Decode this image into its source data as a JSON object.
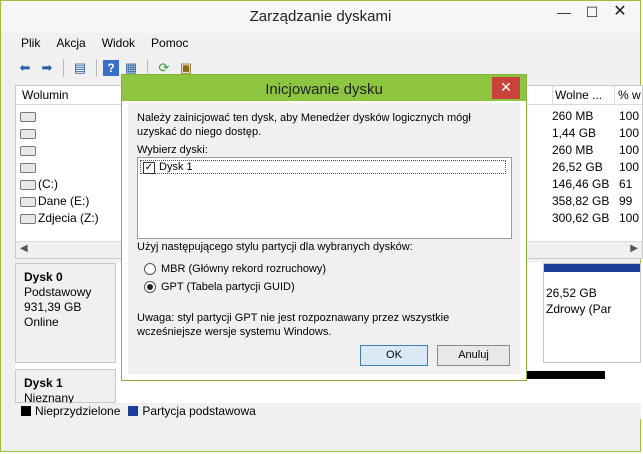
{
  "window": {
    "title": "Zarządzanie dyskami",
    "minimize": "—",
    "maximize": "☐",
    "close": "✕"
  },
  "menu": {
    "items": [
      "Plik",
      "Akcja",
      "Widok",
      "Pomoc"
    ]
  },
  "list": {
    "columns": {
      "volume": "Wolumin",
      "free": "Wolne ...",
      "pct": "% w"
    },
    "rows": [
      {
        "name": "",
        "free": "260 MB",
        "pct": "100"
      },
      {
        "name": "",
        "free": "1,44 GB",
        "pct": "100"
      },
      {
        "name": "",
        "free": "260 MB",
        "pct": "100"
      },
      {
        "name": "",
        "free": "26,52 GB",
        "pct": "100"
      },
      {
        "name": "(C:)",
        "free": "146,46 GB",
        "pct": "61"
      },
      {
        "name": "Dane (E:)",
        "free": "358,82 GB",
        "pct": "99"
      },
      {
        "name": "Zdjecia (Z:)",
        "free": "300,62 GB",
        "pct": "100"
      }
    ]
  },
  "disks": {
    "disk0": {
      "name": "Dysk 0",
      "type": "Podstawowy",
      "size": "931,39 GB",
      "status": "Online"
    },
    "disk0_partition": {
      "size": "26,52 GB",
      "status": "Zdrowy (Par"
    },
    "disk1": {
      "name": "Dysk 1",
      "type": "Nieznany"
    }
  },
  "legend": {
    "unallocated": "Nieprzydzielone",
    "unallocated_color": "#000000",
    "primary": "Partycja podstawowa",
    "primary_color": "#1d3e98"
  },
  "dialog": {
    "title": "Inicjowanie dysku",
    "intro": "Należy zainicjować ten dysk, aby Menedżer dysków logicznych mógł uzyskać do niego dostęp.",
    "select_label": "Wybierz dyski:",
    "disk_item": "Dysk 1",
    "style_label": "Użyj następującego stylu partycji dla wybranych dysków:",
    "mbr_label": "MBR (Główny rekord rozruchowy)",
    "gpt_label": "GPT (Tabela partycji GUID)",
    "note": "Uwaga: styl partycji GPT nie jest rozpoznawany przez wszystkie wcześniejsze wersje systemu Windows.",
    "ok": "OK",
    "cancel": "Anuluj",
    "close": "✕"
  }
}
